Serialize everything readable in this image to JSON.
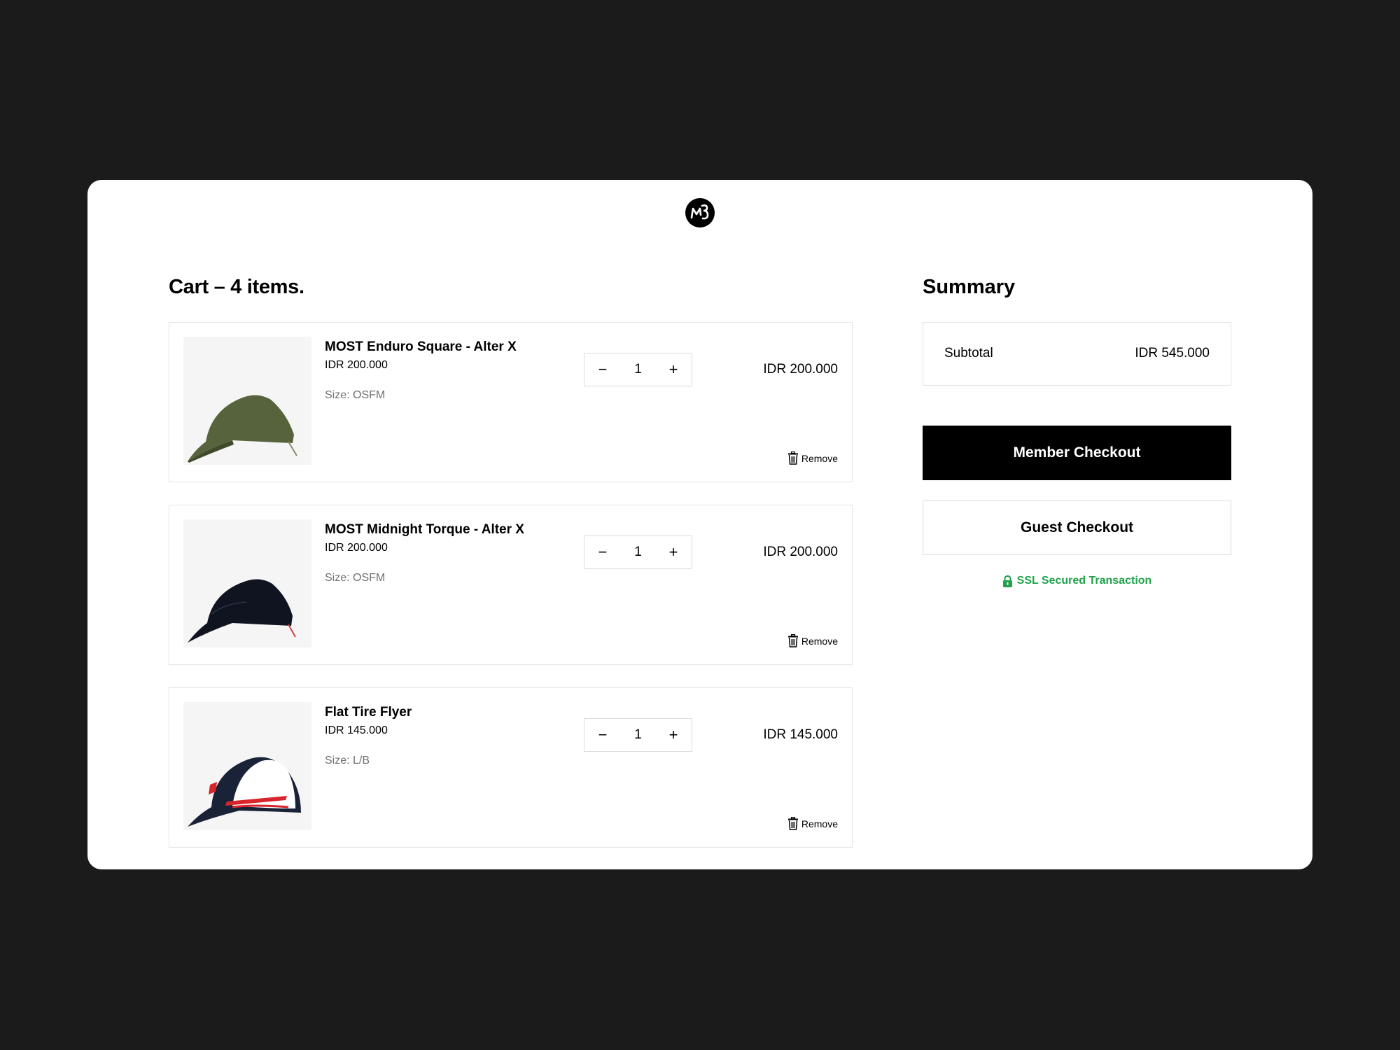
{
  "cart": {
    "title": "Cart – 4 items.",
    "items": [
      {
        "name": "MOST Enduro Square - Alter X",
        "unit_price": "IDR 200.000",
        "size": "Size: OSFM",
        "quantity": "1",
        "total": "IDR 200.000",
        "remove_label": "Remove",
        "cap_color": "#56633c"
      },
      {
        "name": "MOST Midnight Torque - Alter X",
        "unit_price": "IDR 200.000",
        "size": "Size: OSFM",
        "quantity": "1",
        "total": "IDR 200.000",
        "remove_label": "Remove",
        "cap_color": "#0f1420"
      },
      {
        "name": "Flat Tire Flyer",
        "unit_price": "IDR 145.000",
        "size": "Size: L/B",
        "quantity": "1",
        "total": "IDR 145.000",
        "remove_label": "Remove",
        "cap_color": "#ffffff",
        "cap_brim_color": "#1a2238",
        "cap_accent_color": "#d8242b"
      }
    ],
    "decrement_symbol": "−",
    "increment_symbol": "+"
  },
  "summary": {
    "title": "Summary",
    "subtotal_label": "Subtotal",
    "subtotal_value": "IDR 545.000",
    "member_checkout_label": "Member Checkout",
    "guest_checkout_label": "Guest Checkout",
    "ssl_label": "SSL Secured Transaction"
  },
  "colors": {
    "page_background": "#1b1b1b",
    "primary_button": "#000000",
    "ssl_green": "#1fa24a"
  },
  "icons": {
    "logo": "brand-logo-icon",
    "remove": "trash-icon",
    "ssl": "lock-icon"
  }
}
